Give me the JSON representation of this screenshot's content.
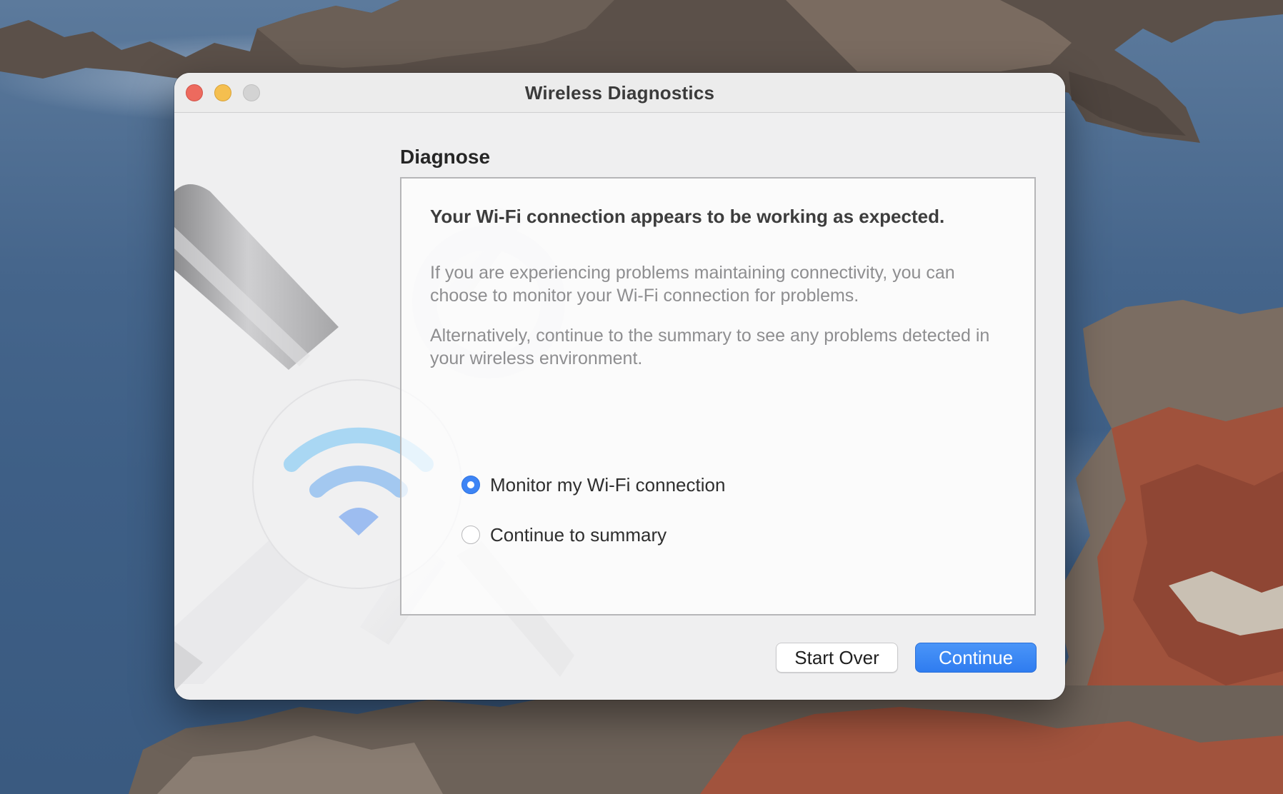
{
  "window": {
    "title": "Wireless Diagnostics"
  },
  "section": {
    "title": "Diagnose"
  },
  "panel": {
    "headline": "Your Wi-Fi connection appears to be working as expected.",
    "paragraph1": "If you are experiencing problems maintaining connectivity, you can choose to monitor your Wi-Fi connection for problems.",
    "paragraph2": "Alternatively, continue to the summary to see any problems detected in your wireless environment.",
    "options": [
      {
        "label": "Monitor my Wi-Fi connection",
        "selected": true
      },
      {
        "label": "Continue to summary",
        "selected": false
      }
    ]
  },
  "buttons": {
    "start_over": "Start Over",
    "continue": "Continue"
  },
  "colors": {
    "accent": "#3d84f5",
    "close": "#ed6a5e",
    "minimize": "#f5bf4f",
    "zoom_disabled": "#d3d3d3"
  },
  "icons": [
    "close-icon",
    "minimize-icon",
    "zoom-icon",
    "wrench-icon",
    "screwdriver-icon",
    "wifi-icon"
  ]
}
